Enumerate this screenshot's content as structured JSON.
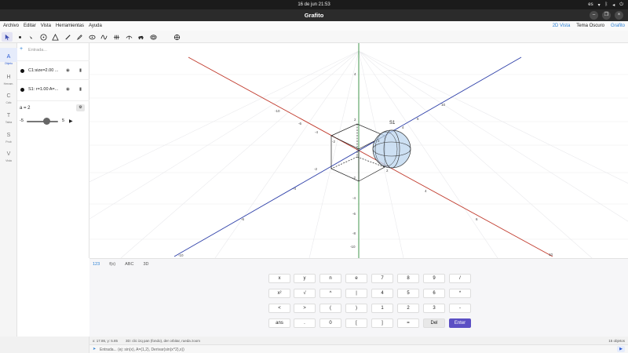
{
  "system": {
    "clock": "16 de jun  21:53",
    "lang": "es"
  },
  "window": {
    "title": "Grafito"
  },
  "menu": {
    "items": [
      "Archivo",
      "Editar",
      "Vista",
      "Herramientas",
      "Ayuda"
    ],
    "right": {
      "view_2d": "2D Vista",
      "theme": "Tema Oscuro",
      "brand": "Grafito"
    }
  },
  "toolbar": {
    "tools": [
      "pointer-icon",
      "point-icon",
      "cursor-small-icon",
      "circle-point-icon",
      "triangle-icon",
      "pen-icon",
      "pencil-icon",
      "ellipse-icon",
      "wave-icon",
      "hash-icon",
      "curve-icon",
      "car-icon",
      "ring-icon",
      "crosshair-icon"
    ]
  },
  "rail": [
    {
      "letter": "A",
      "label": "Objeto",
      "active": true
    },
    {
      "letter": "H",
      "label": "Herram.",
      "active": false
    },
    {
      "letter": "C",
      "label": "Cálc",
      "active": false
    },
    {
      "letter": "T",
      "label": "Tabla",
      "active": false
    },
    {
      "letter": "S",
      "label": "Prob",
      "active": false
    },
    {
      "letter": "V",
      "label": "Vista",
      "active": false
    }
  ],
  "algebra": {
    "input_placeholder": "Entrada...",
    "objects": [
      {
        "text": "C1:size=2.00 ..."
      },
      {
        "text": "S1: r=1.00  A=..."
      }
    ],
    "slider": {
      "name": "a = 2",
      "min": "-5",
      "max": "5",
      "value": 2
    }
  },
  "graph": {
    "tick_labels": {
      "x_red": [
        "-10",
        "-6",
        "-4",
        "-2",
        "2",
        "4",
        "6",
        "10"
      ],
      "y_blue": [
        "10",
        "6",
        "4",
        "2",
        "-2",
        "-4",
        "-6",
        "-10"
      ],
      "z_green": [
        "4",
        "2",
        "-2",
        "-4",
        "-6",
        "-8",
        "-10"
      ]
    },
    "sphere_label": "S1",
    "colors": {
      "x_axis": "#c0392b",
      "y_axis": "#2c3ea8",
      "z_axis": "#2e8b3a",
      "sphere_fill": "#bcd6ef"
    }
  },
  "keyboard": {
    "tabs": [
      "123",
      "f(x)",
      "ABC",
      "3D"
    ],
    "rows": [
      [
        "x",
        "y",
        "n",
        "e",
        "7",
        "8",
        "9",
        "/"
      ],
      [
        "x²",
        "√",
        "^",
        "|",
        "4",
        "5",
        "6",
        "*"
      ],
      [
        "<",
        ">",
        "(",
        ")",
        "1",
        "2",
        "3",
        "-"
      ],
      [
        "ans",
        ".",
        "0",
        "[",
        "]",
        "=",
        "Del",
        "Enter"
      ]
    ]
  },
  "status": {
    "coords": "x: 17.86, y: 5.85",
    "hint": "3D: clic izq pan (fondo), der orbitar, rueda zoom",
    "count": "15 objetos"
  },
  "inputbar": {
    "placeholder": "Entrada... (ej: sin(x), A=(1,2), Derivar(sin(x^2),x))"
  }
}
